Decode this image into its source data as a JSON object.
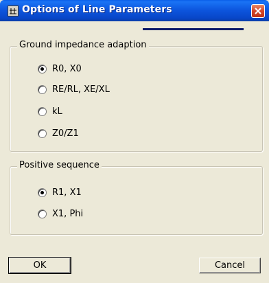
{
  "window": {
    "title": "Options of Line Parameters",
    "icon": "line-parameters-app-icon",
    "close_icon": "close-icon"
  },
  "ground_group": {
    "legend": "Ground impedance adaption",
    "options": [
      {
        "label": "R0, X0",
        "checked": true
      },
      {
        "label": "RE/RL, XE/XL",
        "checked": false
      },
      {
        "label": "kL",
        "checked": false
      },
      {
        "label": "Z0/Z1",
        "checked": false
      }
    ]
  },
  "positive_group": {
    "legend": "Positive sequence",
    "options": [
      {
        "label": "R1, X1",
        "checked": true
      },
      {
        "label": "X1, Phi",
        "checked": false
      }
    ]
  },
  "buttons": {
    "ok": "OK",
    "cancel": "Cancel"
  }
}
